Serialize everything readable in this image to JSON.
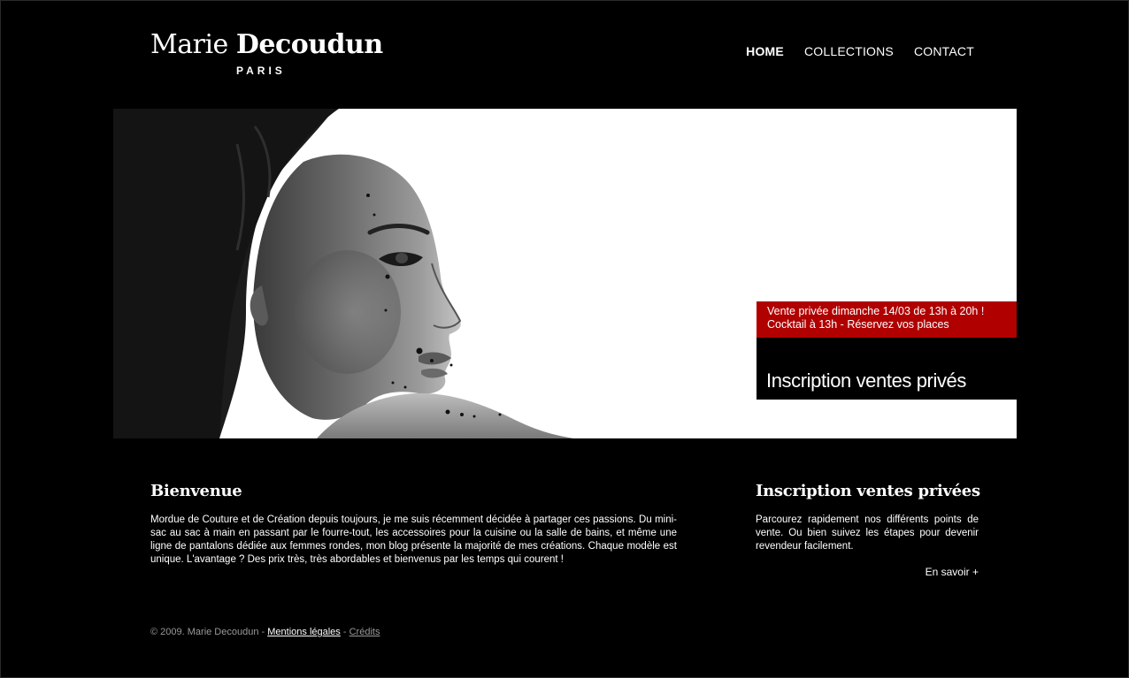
{
  "brand": {
    "first_name": "Marie",
    "last_name": "Decoudun",
    "city": "PARIS"
  },
  "nav": {
    "items": [
      {
        "label": "HOME",
        "active": true
      },
      {
        "label": "COLLECTIONS",
        "active": false
      },
      {
        "label": "CONTACT",
        "active": false
      }
    ]
  },
  "hero": {
    "image_subject": "black-and-white portrait of a woman",
    "promo_line1": "Vente privée dimanche 14/03 de 13h à 20h !",
    "promo_line2": "Cocktail à 13h - Réservez vos places",
    "cta_label": "Inscription ventes privés",
    "accent_color": "#b00000"
  },
  "welcome": {
    "title": "Bienvenue",
    "body": "Mordue de Couture et de Création depuis toujours, je me suis récemment décidée à partager ces passions. Du mini-sac au sac à main en passant par le fourre-tout, les accessoires pour la cuisine ou la salle de bains, et même une ligne de pantalons dédiée aux femmes rondes, mon blog présente la majorité de mes créations. Chaque modèle est unique. L'avantage ? Des prix très, très abordables et bienvenus par les temps qui courent !"
  },
  "signup": {
    "title": "Inscription ventes privées",
    "body": "Parcourez rapidement nos différents points de vente. Ou bien suivez les étapes pour devenir revendeur facilement.",
    "more_label": "En savoir +"
  },
  "footer": {
    "copyright": "© 2009. Marie Decoudun -",
    "legal_link": "Mentions légales",
    "separator": "-",
    "credits_link": "Crédits"
  }
}
